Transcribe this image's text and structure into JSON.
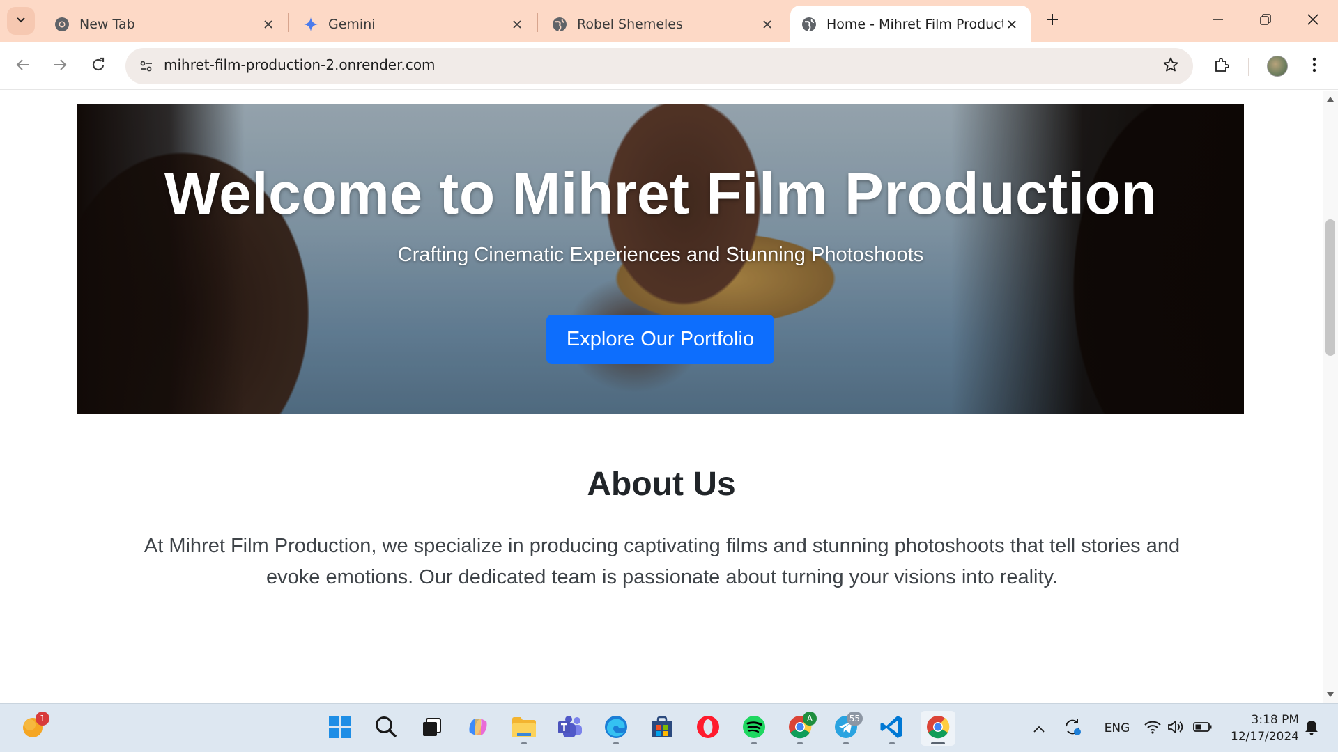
{
  "browser": {
    "tabs": [
      {
        "title": "New Tab",
        "icon": "chrome-icon"
      },
      {
        "title": "Gemini",
        "icon": "gemini-sparkle-icon"
      },
      {
        "title": "Robel Shemeles",
        "icon": "globe-icon"
      },
      {
        "title": "Home - Mihret Film Production",
        "icon": "globe-icon",
        "active": true
      }
    ],
    "url": "mihret-film-production-2.onrender.com"
  },
  "page": {
    "hero": {
      "title": "Welcome to Mihret Film Production",
      "subtitle": "Crafting Cinematic Experiences and Stunning Photoshoots",
      "button_label": "Explore Our Portfolio",
      "button_color": "#0d6efd"
    },
    "about": {
      "title": "About Us",
      "text": "At Mihret Film Production, we specialize in producing captivating films and stunning photoshoots that tell stories and evoke emotions. Our dedicated team is passionate about turning your visions into reality."
    }
  },
  "taskbar": {
    "weather_badge": "1",
    "telegram_badge": "55",
    "chrome_profile_badge": "A",
    "language": "ENG",
    "time": "3:18 PM",
    "date": "12/17/2024"
  },
  "colors": {
    "tabstrip": "#fdd9c6",
    "accent": "#0d6efd",
    "taskbar": "#dde7f1"
  }
}
